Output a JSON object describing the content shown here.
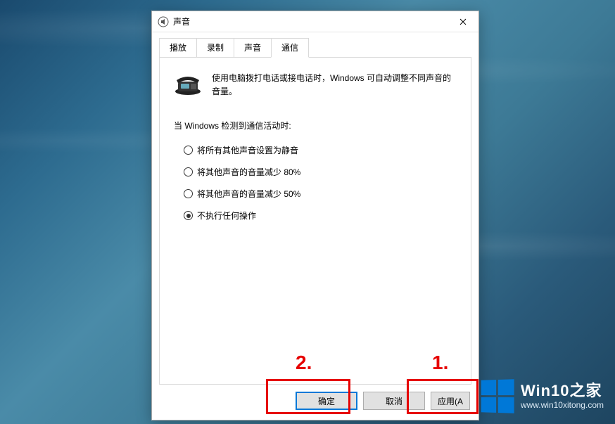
{
  "dialog": {
    "title": "声音",
    "tabs": [
      "播放",
      "录制",
      "声音",
      "通信"
    ],
    "activeTabIndex": 3,
    "description": "使用电脑拨打电话或接电话时，Windows 可自动调整不同声音的音量。",
    "sectionLabel": "当 Windows 检测到通信活动时:",
    "options": [
      {
        "label": "将所有其他声音设置为静音",
        "checked": false
      },
      {
        "label": "将其他声音的音量减少 80%",
        "checked": false
      },
      {
        "label": "将其他声音的音量减少 50%",
        "checked": false
      },
      {
        "label": "不执行任何操作",
        "checked": true
      }
    ],
    "buttons": {
      "ok": "确定",
      "cancel": "取消",
      "apply": "应用(A"
    }
  },
  "annotations": {
    "label1": "1.",
    "label2": "2."
  },
  "watermark": {
    "title": "Win10之家",
    "url": "www.win10xitong.com"
  }
}
